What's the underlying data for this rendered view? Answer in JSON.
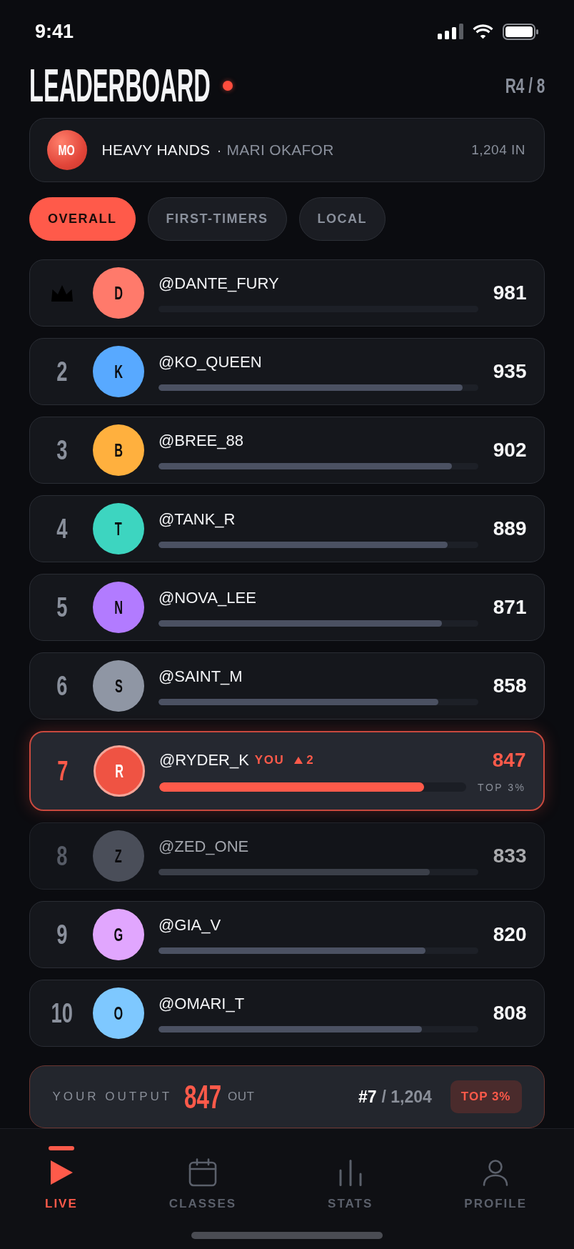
{
  "status_bar": {
    "time": "9:41"
  },
  "header": {
    "title": "LEADERBOARD",
    "live": true,
    "round": "R4 / 8"
  },
  "class_card": {
    "initials": "MO",
    "class_name": "HEAVY HANDS",
    "separator": "·",
    "instructor": "MARI OKAFOR",
    "participants": "1,204 IN"
  },
  "tabs": [
    {
      "label": "OVERALL",
      "selected": true
    },
    {
      "label": "FIRST-TIMERS",
      "selected": false
    },
    {
      "label": "LOCAL",
      "selected": false
    }
  ],
  "rows": [
    {
      "kind": "leader",
      "initial": "D",
      "color": "#ff7a6b",
      "handle": "@DANTE_FURY",
      "score": "981",
      "dimmed": false
    },
    {
      "kind": "player",
      "rank": "2",
      "initial": "K",
      "color": "#58a9ff",
      "handle": "@KO_QUEEN",
      "level": 0.953,
      "score": "935",
      "dimmed": false
    },
    {
      "kind": "player",
      "rank": "3",
      "initial": "B",
      "color": "#ffb03e",
      "handle": "@BREE_88",
      "level": 0.919,
      "score": "902",
      "dimmed": false
    },
    {
      "kind": "player",
      "rank": "4",
      "initial": "T",
      "color": "#3dd5c0",
      "handle": "@TANK_R",
      "level": 0.906,
      "score": "889",
      "dimmed": false
    },
    {
      "kind": "player",
      "rank": "5",
      "initial": "N",
      "color": "#b27bff",
      "handle": "@NOVA_LEE",
      "level": 0.888,
      "score": "871",
      "dimmed": false
    },
    {
      "kind": "player",
      "rank": "6",
      "initial": "S",
      "color": "#8f96a4",
      "handle": "@SAINT_M",
      "level": 0.875,
      "score": "858",
      "dimmed": false
    },
    {
      "kind": "self",
      "rank": "7",
      "initial": "R",
      "color": "#ef5343",
      "handle": "@RYDER_K",
      "tag": "YOU",
      "rising": true,
      "change": "2",
      "level": 0.863,
      "score": "847",
      "standing": "TOP 3%",
      "dimmed": false
    },
    {
      "kind": "player",
      "rank": "8",
      "initial": "Z",
      "color": "#4a4e59",
      "handle": "@ZED_ONE",
      "level": 0.849,
      "score": "833",
      "dimmed": true
    },
    {
      "kind": "player",
      "rank": "9",
      "initial": "G",
      "color": "#e1a6fe",
      "handle": "@GIA_V",
      "level": 0.836,
      "score": "820",
      "dimmed": false
    },
    {
      "kind": "player",
      "rank": "10",
      "initial": "O",
      "color": "#7ec8ff",
      "handle": "@OMARI_T",
      "level": 0.824,
      "score": "808",
      "dimmed": false
    }
  ],
  "output_bar": {
    "label": "YOUR OUTPUT",
    "value": "847",
    "unit": "OUT",
    "position": "#7",
    "total": "/ 1,204",
    "badge": "TOP 3%"
  },
  "nav": [
    {
      "label": "LIVE",
      "selected": true
    },
    {
      "label": "CLASSES",
      "selected": false
    },
    {
      "label": "STATS",
      "selected": false
    },
    {
      "label": "PROFILE",
      "selected": false
    }
  ]
}
